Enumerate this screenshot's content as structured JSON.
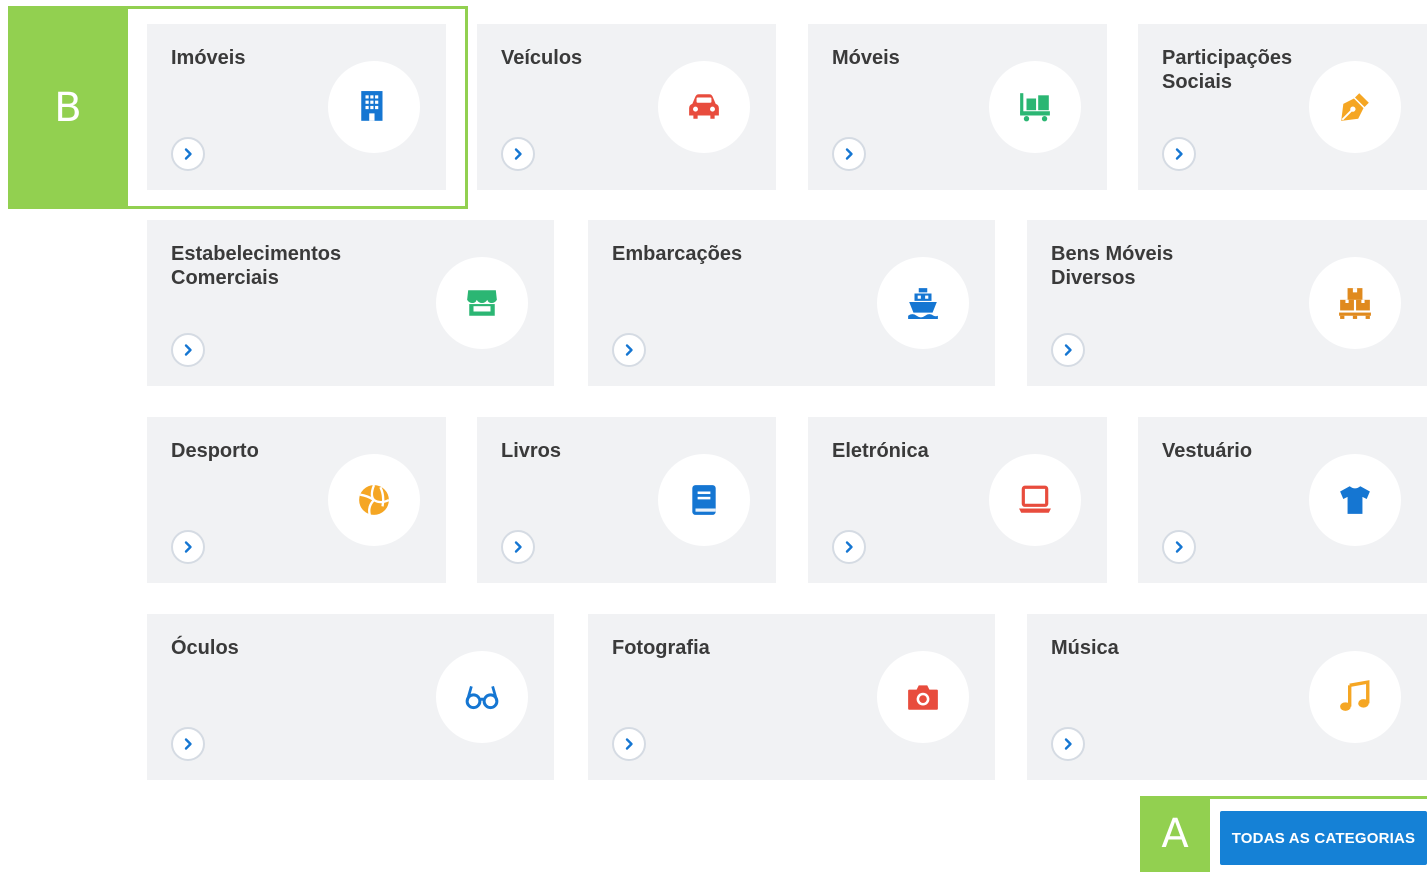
{
  "annotations": {
    "tag_a": "A",
    "tag_b": "B"
  },
  "categories": [
    {
      "title": "Imóveis",
      "icon": "building-icon",
      "color": "#1576d2"
    },
    {
      "title": "Veículos",
      "icon": "car-icon",
      "color": "#e84c3d"
    },
    {
      "title": "Móveis",
      "icon": "furniture-cart-icon",
      "color": "#2bb673"
    },
    {
      "title": "Participações\nSociais",
      "icon": "pen-nib-icon",
      "color": "#f5a623"
    },
    {
      "title": "Estabelecimentos\nComerciais",
      "icon": "store-icon",
      "color": "#2bb673"
    },
    {
      "title": "Embarcações",
      "icon": "ship-icon",
      "color": "#1576d2"
    },
    {
      "title": "Bens Móveis\nDiversos",
      "icon": "pallet-boxes-icon",
      "color": "#e08a1e"
    },
    {
      "title": "Desporto",
      "icon": "volleyball-icon",
      "color": "#f5a623"
    },
    {
      "title": "Livros",
      "icon": "book-icon",
      "color": "#1576d2"
    },
    {
      "title": "Eletrónica",
      "icon": "laptop-icon",
      "color": "#e84c3d"
    },
    {
      "title": "Vestuário",
      "icon": "tshirt-icon",
      "color": "#1576d2"
    },
    {
      "title": "Óculos",
      "icon": "glasses-icon",
      "color": "#1576d2"
    },
    {
      "title": "Fotografia",
      "icon": "camera-icon",
      "color": "#e84c3d"
    },
    {
      "title": "Música",
      "icon": "music-note-icon",
      "color": "#f5a623"
    }
  ],
  "all_categories_button": {
    "label": "TODAS AS CATEGORIAS",
    "color": "#1581d6"
  },
  "colors": {
    "card_bg": "#f1f2f4",
    "highlight": "#92d050",
    "chevron": "#1576d2"
  }
}
